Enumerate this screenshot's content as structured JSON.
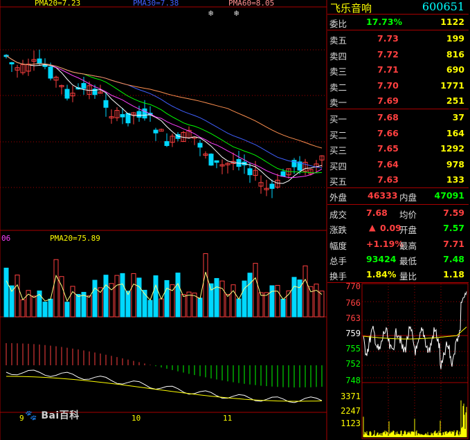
{
  "main_chart": {
    "ma_labels": [
      {
        "text": "PMA20=7.23",
        "color": "#ffff00"
      },
      {
        "text": "PMA30=7.38",
        "color": "#4060ff"
      },
      {
        "text": "PMA60=8.05",
        "color": "#ff9090"
      }
    ],
    "snow_icons": [
      "snowflake-icon",
      "snowflake-icon"
    ],
    "volume_label_left": "06",
    "volume_ma_label": "PMA20=75.89",
    "x_labels": [
      "9",
      "10",
      "11"
    ]
  },
  "quote_panel": {
    "name": "飞乐音响",
    "code": "600651",
    "ratio": {
      "label": "委比",
      "value": "17.73%",
      "diff": "1122"
    },
    "asks": [
      {
        "label": "卖五",
        "price": "7.73",
        "volume": "199"
      },
      {
        "label": "卖四",
        "price": "7.72",
        "volume": "816"
      },
      {
        "label": "卖三",
        "price": "7.71",
        "volume": "690"
      },
      {
        "label": "卖二",
        "price": "7.70",
        "volume": "1771"
      },
      {
        "label": "卖一",
        "price": "7.69",
        "volume": "251"
      }
    ],
    "bids": [
      {
        "label": "买一",
        "price": "7.68",
        "volume": "37"
      },
      {
        "label": "买二",
        "price": "7.66",
        "volume": "164"
      },
      {
        "label": "买三",
        "price": "7.65",
        "volume": "1292"
      },
      {
        "label": "买四",
        "price": "7.64",
        "volume": "978"
      },
      {
        "label": "买五",
        "price": "7.63",
        "volume": "133"
      }
    ],
    "outer_label": "外盘",
    "outer_value": "46333",
    "inner_label": "内盘",
    "inner_value": "47091",
    "stats": [
      {
        "k1": "成交",
        "v1": "7.68",
        "c1": "red",
        "k2": "均价",
        "v2": "7.59",
        "c2": "red"
      },
      {
        "k1": "涨跌",
        "v1": "0.09",
        "c1": "red",
        "k2": "开盘",
        "v2": "7.57",
        "c2": "green"
      },
      {
        "k1": "幅度",
        "v1": "+1.19%",
        "c1": "red",
        "k2": "最高",
        "v2": "7.71",
        "c2": "red"
      },
      {
        "k1": "总手",
        "v1": "93424",
        "c1": "green",
        "k2": "最低",
        "v2": "7.48",
        "c2": "green"
      },
      {
        "k1": "换手",
        "v1": "1.84%",
        "c1": "yellow",
        "k2": "量比",
        "v2": "1.18",
        "c2": "yellow"
      }
    ],
    "up_arrow_icon": "up-triangle-icon"
  },
  "mini_chart": {
    "price_ticks": [
      "7.70",
      "7.66",
      "7.63",
      "7.59",
      "7.55",
      "7.52",
      "7.48"
    ],
    "volume_ticks": [
      "3371",
      "2247",
      "1123"
    ]
  },
  "watermark": {
    "text": "Bai百科"
  }
}
